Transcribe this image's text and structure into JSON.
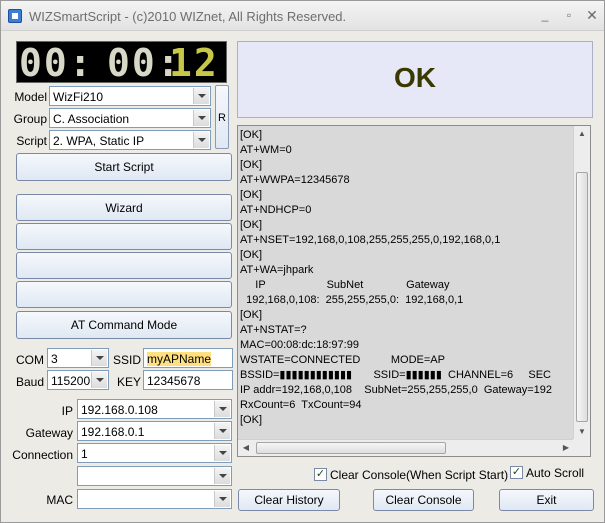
{
  "window": {
    "title": "WIZSmartScript - (c)2010 WIZnet, All Rights Reserved.",
    "min_label": "_",
    "max_label": "▫",
    "close_label": "✕"
  },
  "clock": {
    "hours": "00",
    "minutes": "00",
    "seconds": "12",
    "sep1": ":",
    "sep2": ":"
  },
  "settings": {
    "model_label": "Model",
    "model_value": "WizFi210",
    "group_label": "Group",
    "group_value": "C. Association",
    "script_label": "Script",
    "script_value": "2. WPA, Static IP",
    "r_button": "R"
  },
  "buttons": {
    "start_script": "Start Script",
    "wizard": "Wizard",
    "blank1": "",
    "blank2": "",
    "blank3": "",
    "at_command_mode": "AT Command Mode",
    "clear_history": "Clear History",
    "clear_console": "Clear Console",
    "exit": "Exit"
  },
  "serial": {
    "com_label": "COM",
    "com_value": "3",
    "baud_label": "Baud",
    "baud_value": "115200",
    "ssid_label": "SSID",
    "ssid_value": "myAPName",
    "key_label": "KEY",
    "key_value": "12345678"
  },
  "network": {
    "ip_label": "IP",
    "ip_value": "192.168.0.108",
    "gateway_label": "Gateway",
    "gateway_value": "192.168.0.1",
    "connection_label": "Connection",
    "connection_value": "1",
    "extra_value": "",
    "mac_label": "MAC",
    "mac_value": ""
  },
  "status": {
    "result": "OK"
  },
  "console": {
    "lines": [
      "[OK]",
      "AT+WM=0",
      "[OK]",
      "AT+WWPA=12345678",
      "[OK]",
      "AT+NDHCP=0",
      "[OK]",
      "AT+NSET=192,168,0,108,255,255,255,0,192,168,0,1",
      "[OK]",
      "AT+WA=jhpark",
      "     IP                    SubNet              Gateway",
      "  192,168,0,108:  255,255,255,0:  192,168,0,1",
      "[OK]",
      "AT+NSTAT=?",
      "MAC=00:08:dc:18:97:99",
      "WSTATE=CONNECTED          MODE=AP",
      "BSSID=▮▮▮▮▮▮▮▮▮▮▮▮       SSID=▮▮▮▮▮▮  CHANNEL=6     SEC",
      "IP addr=192,168,0,108    SubNet=255,255,255,0  Gateway=192",
      "RxCount=6  TxCount=94",
      "[OK]"
    ]
  },
  "options": {
    "clear_console_on_start": "Clear Console(When Script Start)",
    "auto_scroll": "Auto Scroll",
    "check_mark": "✓"
  }
}
